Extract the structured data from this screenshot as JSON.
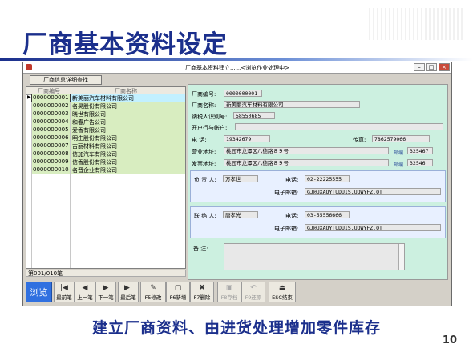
{
  "slide": {
    "title": "厂商基本资料设定",
    "caption": "建立厂商资料、由进货处理增加零件库存",
    "page_number": "10"
  },
  "window": {
    "title": "厂商基本资料建立......<浏览作业处理中>",
    "search_button": "厂商信息详细查找",
    "controls": {
      "minimize": "–",
      "maximize": "□",
      "close": "×"
    }
  },
  "grid": {
    "columns": [
      "厂商编号",
      "厂商名称"
    ],
    "rows": [
      {
        "code": "0000000001",
        "name": "新美丽汽车材料有限公司"
      },
      {
        "code": "0000000002",
        "name": "名昊股份有限公司"
      },
      {
        "code": "0000000003",
        "name": "晓世有限公司"
      },
      {
        "code": "0000000004",
        "name": "和春广告公司"
      },
      {
        "code": "0000000005",
        "name": "爱香有限公司"
      },
      {
        "code": "0000000006",
        "name": "明生股份有限公司"
      },
      {
        "code": "0000000007",
        "name": "吉丽材料有限公司"
      },
      {
        "code": "0000000008",
        "name": "信加汽车有限公司"
      },
      {
        "code": "0000000009",
        "name": "信香股份有限公司"
      },
      {
        "code": "0000000010",
        "name": "名晋企业有限公司"
      }
    ],
    "selected_marker": "▶",
    "record_counter": "第001/010笔"
  },
  "form": {
    "vendor_code_label": "厂商编号:",
    "vendor_code": "0000000001",
    "vendor_name_label": "厂商名称:",
    "vendor_name": "新美丽汽车材料有限公司",
    "tax_id_label": "纳税人识别号:",
    "tax_id": "58550685",
    "bank_label": "开户行与帐户:",
    "bank_account": "",
    "phone_label": "电      话:",
    "phone": "19342679",
    "fax_label": "传真:",
    "fax": "7862579066",
    "business_addr_label": "营业地址:",
    "business_addr": "桃园市龙潭区八德路８９号",
    "business_zip_label": "邮编",
    "business_zip": "325467",
    "invoice_addr_label": "发票地址:",
    "invoice_addr": "桃园市龙潭区八德路８９号",
    "invoice_zip_label": "邮编",
    "invoice_zip": "32546",
    "owner": {
      "label": "负 责 人:",
      "name": "方孝世",
      "phone_label": "电话:",
      "phone": "02-22225555",
      "email_label": "电子邮箱:",
      "email": "GJ@UXAQYTUDUIS.UQWYFZ.QT"
    },
    "contact": {
      "label": "联 络 人:",
      "name": "唐孝光",
      "phone_label": "电话:",
      "phone": "03-55556666",
      "email_label": "电子邮箱:",
      "email": "GJ@UXAQYTUDUIS.UQWYFZ.QT"
    },
    "memo_label": "备      注:",
    "memo": ""
  },
  "toolbar": {
    "browse": "浏览",
    "buttons": [
      {
        "icon": "first-record-icon",
        "glyph": "|◀",
        "label": "最前笔",
        "enabled": true
      },
      {
        "icon": "prev-record-icon",
        "glyph": "◀",
        "label": "上一笔",
        "enabled": true
      },
      {
        "icon": "next-record-icon",
        "glyph": "▶",
        "label": "下一笔",
        "enabled": true
      },
      {
        "icon": "last-record-icon",
        "glyph": "▶|",
        "label": "最后笔",
        "enabled": true
      },
      {
        "icon": "edit-icon",
        "glyph": "✎",
        "label": "F5修改",
        "enabled": true
      },
      {
        "icon": "new-icon",
        "glyph": "▢",
        "label": "F6新增",
        "enabled": true
      },
      {
        "icon": "delete-icon",
        "glyph": "✖",
        "label": "F7删除",
        "enabled": true
      },
      {
        "icon": "save-icon",
        "glyph": "▣",
        "label": "F8存档",
        "enabled": false
      },
      {
        "icon": "undo-icon",
        "glyph": "↶",
        "label": "F9还原",
        "enabled": false
      },
      {
        "icon": "exit-icon",
        "glyph": "⏏",
        "label": "ESC结束",
        "enabled": true
      }
    ]
  },
  "colors": {
    "title_blue": "#1b2f8c",
    "form_background": "#ccf0e0",
    "grid_cell": "#d8edc0",
    "selected_cell": "#c2f0ff",
    "browse_button": "#3070e0"
  }
}
